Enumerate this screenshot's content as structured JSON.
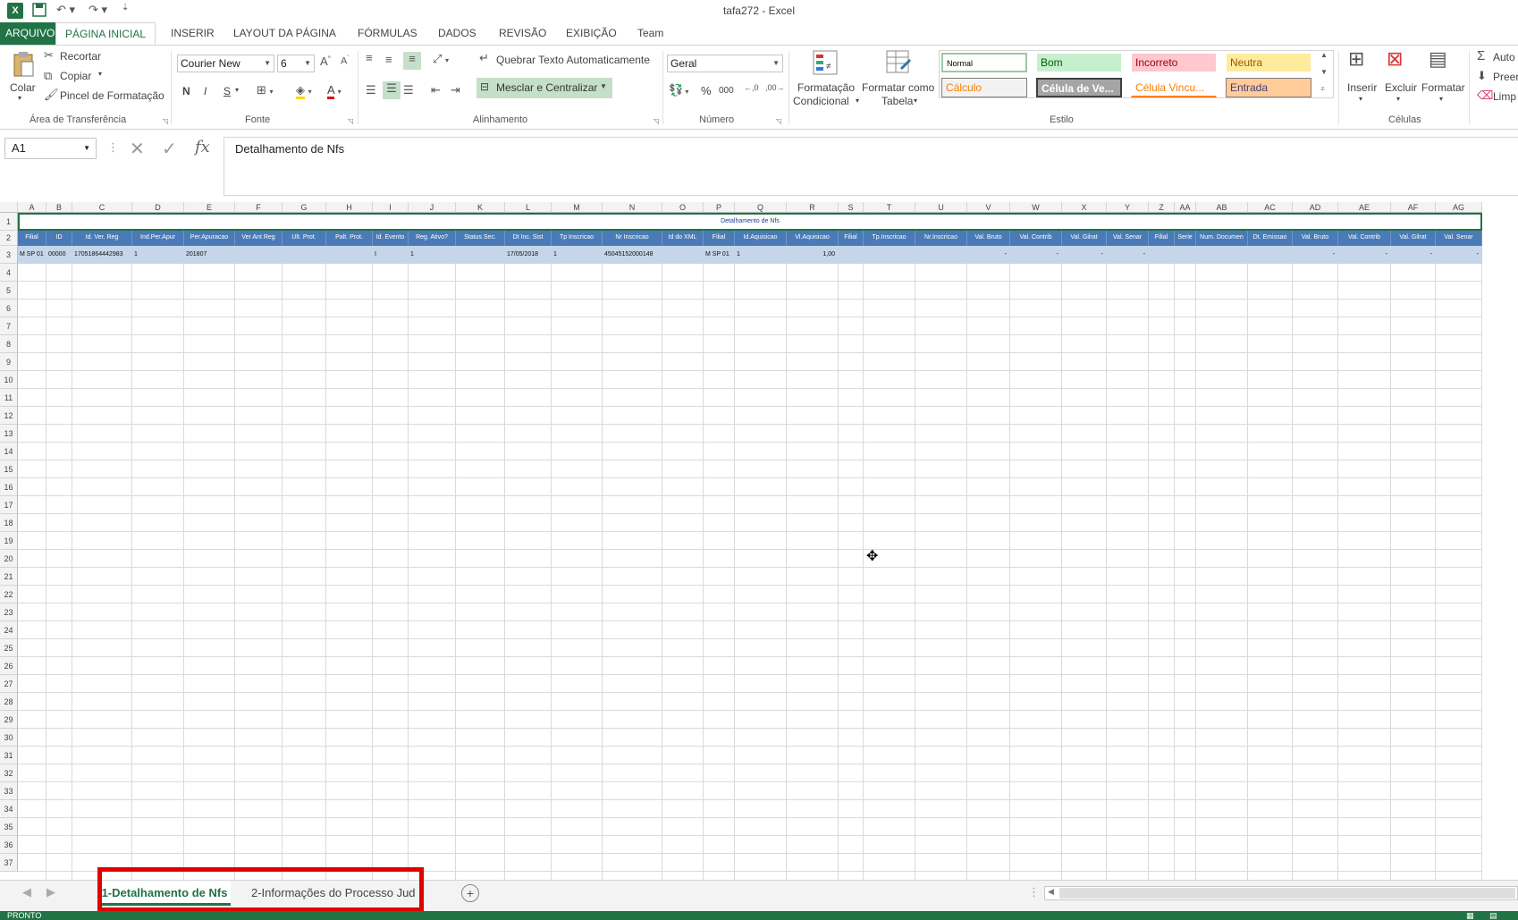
{
  "window": {
    "title": "tafa272 - Excel"
  },
  "tabs": [
    "ARQUIVO",
    "PÁGINA INICIAL",
    "INSERIR",
    "LAYOUT DA PÁGINA",
    "FÓRMULAS",
    "DADOS",
    "REVISÃO",
    "EXIBIÇÃO",
    "Team"
  ],
  "ribbon": {
    "clipboard": {
      "paste": "Colar",
      "cut": "Recortar",
      "copy": "Copiar",
      "format_painter": "Pincel de Formatação",
      "label": "Área de Transferência"
    },
    "font": {
      "name": "Courier New",
      "size": "6",
      "bold": "N",
      "italic": "I",
      "underline": "S",
      "label": "Fonte"
    },
    "alignment": {
      "wrap": "Quebrar Texto Automaticamente",
      "merge": "Mesclar e Centralizar",
      "label": "Alinhamento"
    },
    "number": {
      "format": "Geral",
      "percent": "%",
      "thousands": "000",
      "label": "Número"
    },
    "styles": {
      "conditional": [
        "Formatação",
        "Condicional"
      ],
      "table": [
        "Formatar como",
        "Tabela"
      ],
      "normal": "Normal",
      "good": "Bom",
      "bad": "Incorreto",
      "neutral": "Neutra",
      "calc": "Cálculo",
      "check": "Célula de Ve...",
      "linked": "Célula Vincu...",
      "input": "Entrada",
      "label": "Estilo"
    },
    "cells": {
      "insert": "Inserir",
      "delete": "Excluir",
      "format": "Formatar",
      "label": "Células"
    },
    "editing": {
      "autosum": "Auto",
      "fill": "Preen",
      "clear": "Limp"
    }
  },
  "formula_bar": {
    "name_box": "A1",
    "fx": "fx",
    "content": "Detalhamento de Nfs"
  },
  "sheet": {
    "columns": [
      "A",
      "B",
      "C",
      "D",
      "E",
      "F",
      "G",
      "H",
      "I",
      "J",
      "K",
      "L",
      "M",
      "N",
      "O",
      "P",
      "Q",
      "R",
      "S",
      "T",
      "U",
      "V",
      "W",
      "X",
      "Y",
      "Z",
      "AA",
      "AB",
      "AC",
      "AD",
      "AE",
      "AF",
      "AG"
    ],
    "rows": [
      "1",
      "2",
      "3",
      "4",
      "5",
      "6",
      "7",
      "8",
      "9",
      "10",
      "11",
      "12",
      "13",
      "14",
      "15",
      "16",
      "17",
      "18",
      "19",
      "20",
      "21",
      "22",
      "23",
      "24",
      "25",
      "26",
      "27",
      "28",
      "29",
      "30",
      "31",
      "32",
      "33",
      "34",
      "35",
      "36",
      "37"
    ],
    "title_cell": "Detalhamento de Nfs",
    "headers": [
      "Filial",
      "ID",
      "Id. Ver. Reg",
      "Ind.Per.Apur",
      "Per.Apuracao",
      "Ver Ant Reg",
      "Ult. Prot.",
      "Palt. Prot.",
      "Id. Evento",
      "Reg. Ativo?",
      "Status Sec.",
      "Dt Inc. Sist",
      "Tp Inscricao",
      "Nr Inscricao",
      "Id do XML",
      "Filial",
      "Id.Aquisicao",
      "Vl.Aquisicao",
      "Filial",
      "Tp.Inscricao",
      "Nr.Inscricao",
      "Val. Bruto",
      "Val. Contrib",
      "Val. Gilrat",
      "Val. Senar",
      "Filial",
      "Serie",
      "Num. Documen",
      "Dt. Emissao",
      "Val. Bruto",
      "Val. Contrib",
      "Val. Gilrat",
      "Val. Senar"
    ],
    "row3": [
      "M SP 01",
      "00000",
      "17051864442983",
      "1",
      "201807",
      "",
      "",
      "",
      "I",
      "1",
      "",
      "17/05/2018",
      "1",
      "45045152000148",
      "",
      "M SP 01",
      "1",
      "1,00",
      "",
      "",
      "",
      "-",
      "-",
      "-",
      "-",
      "",
      "",
      "",
      "",
      "-",
      "-",
      "-",
      "-"
    ]
  },
  "sheet_tabs": [
    "1-Detalhamento de Nfs",
    "2-Informações do Processo Jud"
  ],
  "status": "PRONTO",
  "colors": {
    "accent": "#217346",
    "header_fill": "#4a7bb7",
    "row_fill": "#c5d5ea",
    "highlight": "#e00000"
  }
}
